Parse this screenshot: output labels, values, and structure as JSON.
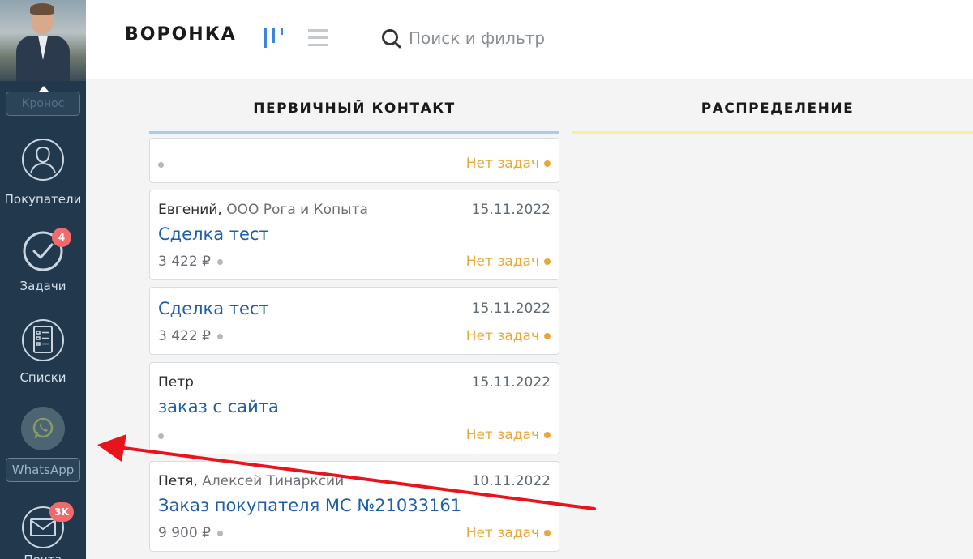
{
  "sidebar": {
    "user_label": "Кронос",
    "items": [
      {
        "label": "Покупатели",
        "icon": "customers-icon"
      },
      {
        "label": "Задачи",
        "icon": "check-circle-icon",
        "badge": "4"
      },
      {
        "label": "Списки",
        "icon": "list-icon"
      },
      {
        "label": "WhatsApp",
        "icon": "whatsapp-icon"
      },
      {
        "label": "Почта",
        "icon": "mail-icon",
        "badge": "3K"
      }
    ]
  },
  "header": {
    "title": "ВОРОНКА",
    "search_placeholder": "Поиск и фильтр"
  },
  "columns": [
    {
      "title": "ПЕРВИЧНЫЙ КОНТАКТ",
      "color": "#a9cde8"
    },
    {
      "title": "РАСПРЕДЕЛЕНИЕ",
      "color": "#f4f0a0"
    }
  ],
  "cards": [
    {
      "contact": "",
      "company": "",
      "date": "",
      "deal": "",
      "price": "",
      "tasks": "Нет задач"
    },
    {
      "contact": "Евгений,",
      "company": "ООО Рога и Копыта",
      "date": "15.11.2022",
      "deal": "Сделка тест",
      "price": "3 422 ₽",
      "tasks": "Нет задач"
    },
    {
      "contact": "",
      "company": "",
      "date": "15.11.2022",
      "deal": "Сделка тест",
      "price": "3 422 ₽",
      "tasks": "Нет задач"
    },
    {
      "contact": "Петр",
      "company": "",
      "date": "15.11.2022",
      "deal": "заказ с сайта",
      "price": "",
      "tasks": "Нет задач"
    },
    {
      "contact": "Петя,",
      "company": "Алексей Тинарксий",
      "date": "10.11.2022",
      "deal": "Заказ покупателя МС №21033161",
      "price": "9 900 ₽",
      "tasks": "Нет задач"
    }
  ],
  "colors": {
    "sidebar_bg": "#22384c",
    "accent_link": "#1f5fa8",
    "tasks_orange": "#e8a838",
    "badge_red": "#f26a6a",
    "annotation_arrow": "#e8141c"
  }
}
